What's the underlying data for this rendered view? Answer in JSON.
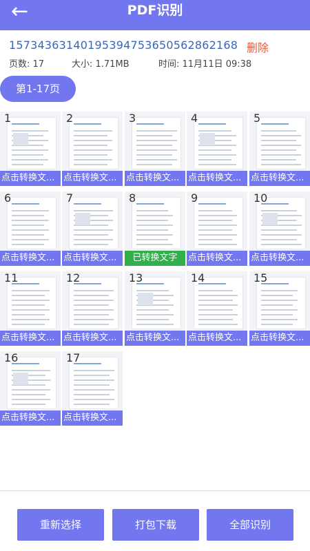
{
  "header": {
    "title": "PDF识别",
    "back_icon": "arrow-left-icon"
  },
  "file": {
    "name": "15734363140195394753650562862168",
    "delete_label": "删除",
    "pages": "页数: 17",
    "size": "大小: 1.71MB",
    "time": "时间: 11月11日 09:38"
  },
  "range_tab": "第1-17页",
  "pages": [
    {
      "num": "1",
      "status": "点击转换文..."
    },
    {
      "num": "2",
      "status": "点击转换文..."
    },
    {
      "num": "3",
      "status": "点击转换文..."
    },
    {
      "num": "4",
      "status": "点击转换文..."
    },
    {
      "num": "5",
      "status": "点击转换文..."
    },
    {
      "num": "6",
      "status": "点击转换文..."
    },
    {
      "num": "7",
      "status": "点击转换文..."
    },
    {
      "num": "8",
      "status": "已转换文字"
    },
    {
      "num": "9",
      "status": "点击转换文..."
    },
    {
      "num": "10",
      "status": "点击转换文..."
    },
    {
      "num": "11",
      "status": "点击转换文..."
    },
    {
      "num": "12",
      "status": "点击转换文..."
    },
    {
      "num": "13",
      "status": "点击转换文..."
    },
    {
      "num": "14",
      "status": "点击转换文..."
    },
    {
      "num": "15",
      "status": "点击转换文..."
    },
    {
      "num": "16",
      "status": "点击转换文..."
    },
    {
      "num": "17",
      "status": "点击转换文..."
    }
  ],
  "footer": {
    "reselect": "重新选择",
    "download": "打包下载",
    "recognize_all": "全部识别"
  },
  "colors": {
    "accent": "#7277f0",
    "converted": "#2fb04a",
    "delete": "#e25a3f",
    "filename": "#3a66b8"
  }
}
